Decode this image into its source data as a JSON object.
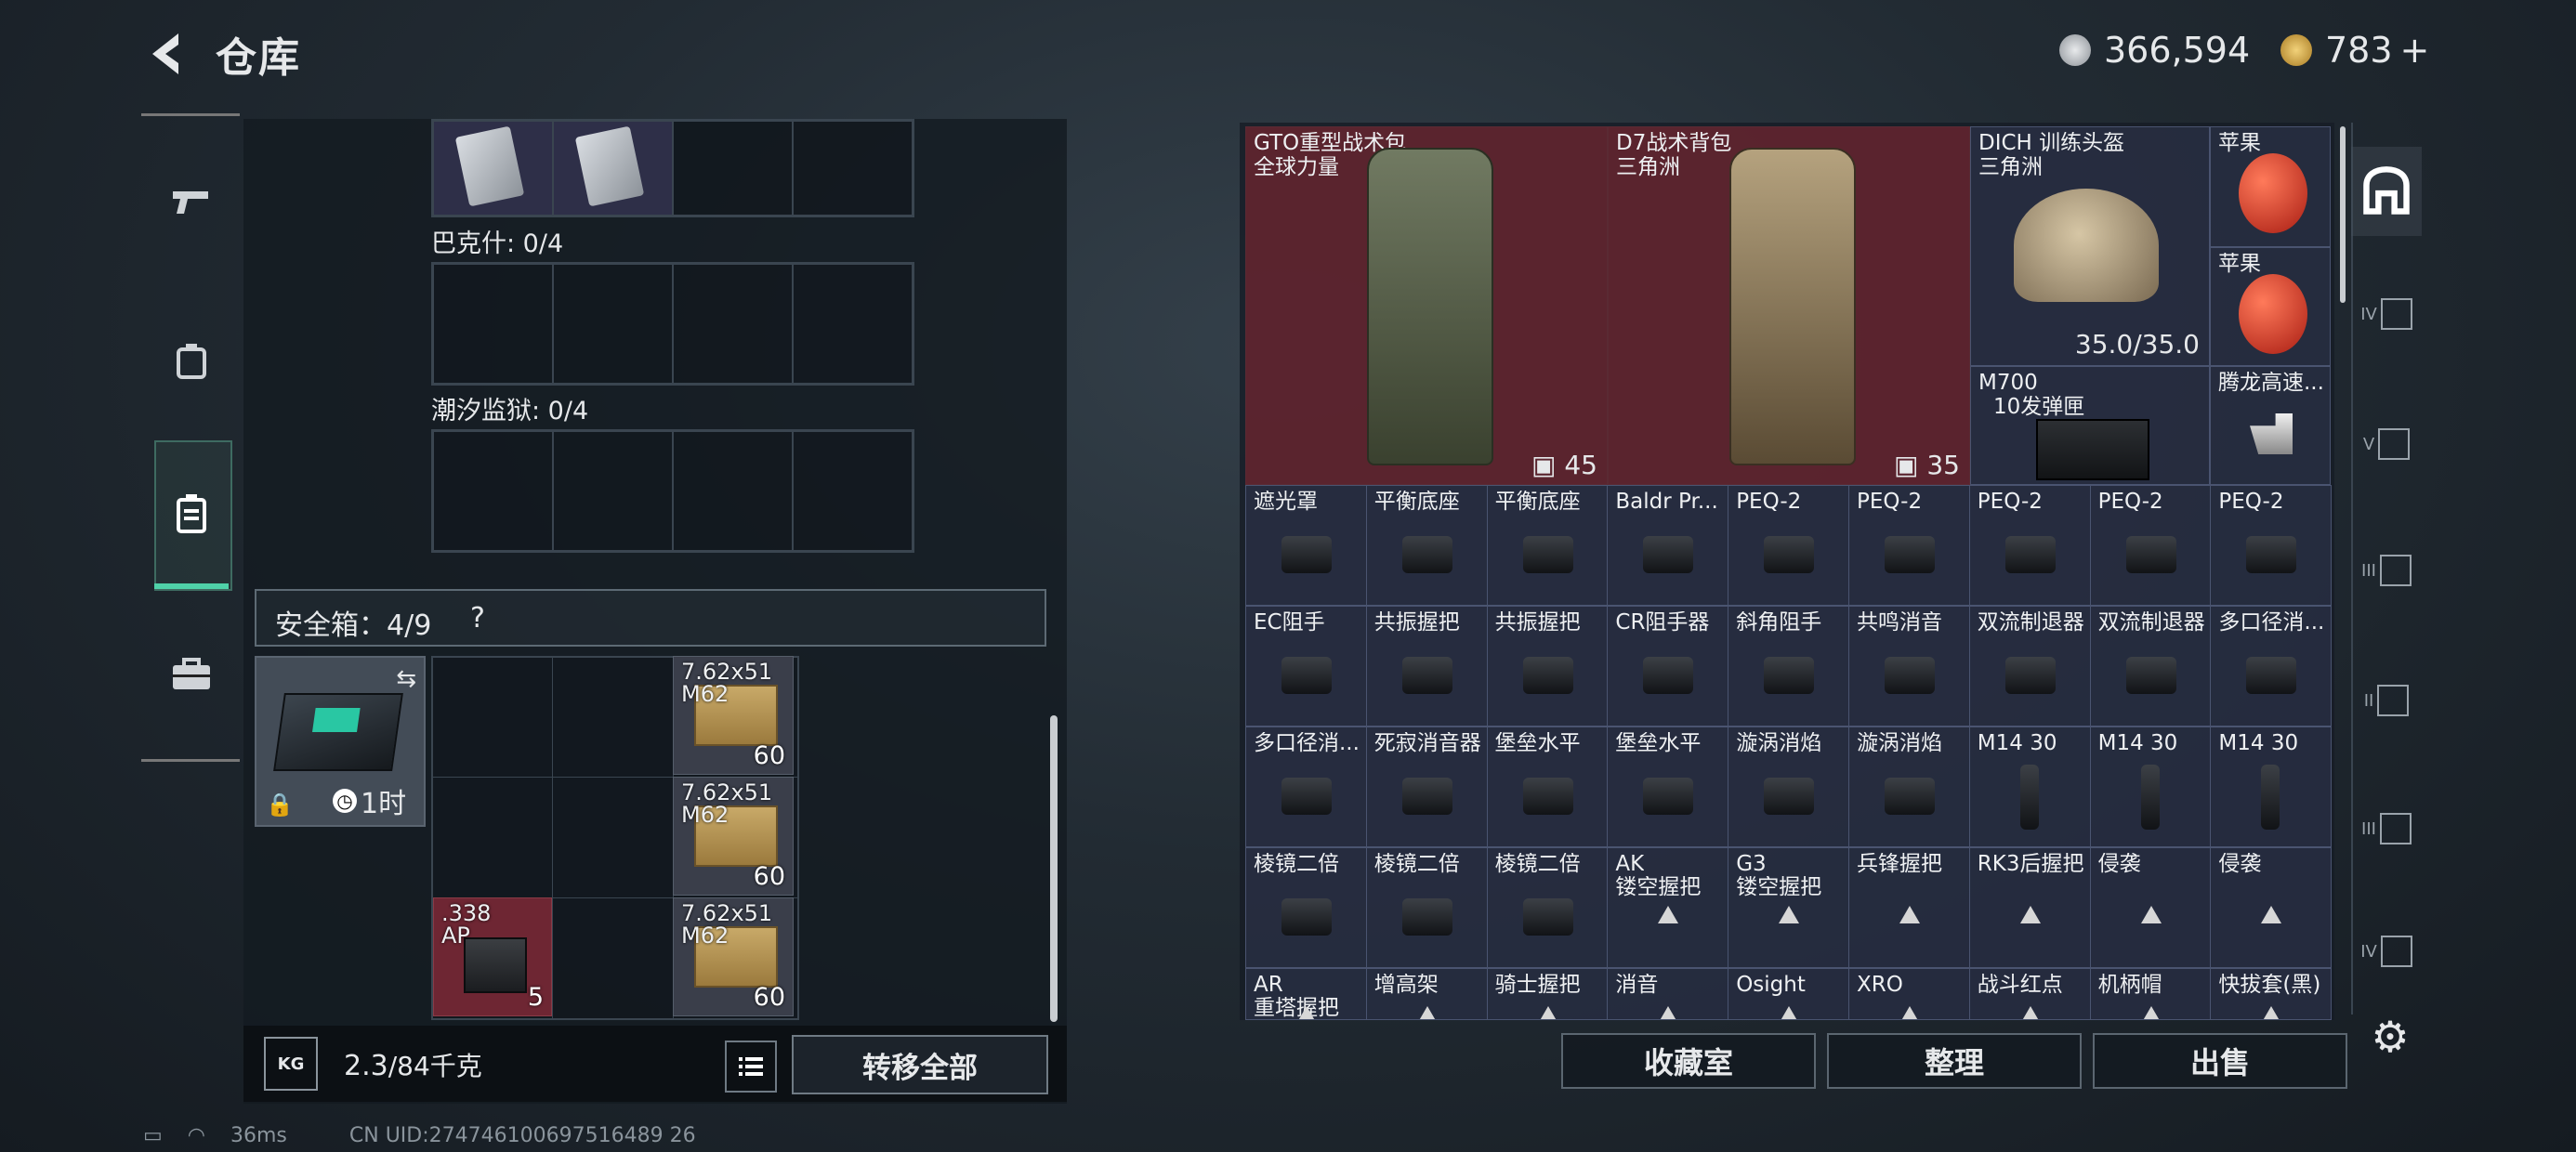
{
  "header": {
    "title": "仓库",
    "currency1": "366,594",
    "currency2": "783",
    "plus": "+"
  },
  "colors": {
    "accent": "#4fd1a8",
    "red_cell": "#702630",
    "grid_cell": "#2c3248"
  },
  "left": {
    "bark_label": "巴克什: 0/4",
    "tide_label": "潮汐监狱: 0/4",
    "safebox": {
      "label": "安全箱：4/9",
      "help": "?",
      "timer": "1时"
    },
    "items": [
      {
        "name": "7.62x51",
        "sub": "M62",
        "count": "60"
      },
      {
        "name": "7.62x51",
        "sub": "M62",
        "count": "60"
      },
      {
        "name": ".338",
        "sub": "AP",
        "count": "5"
      },
      {
        "name": "7.62x51",
        "sub": "M62",
        "count": "60"
      }
    ],
    "weight": "2.3",
    "weight_max": "/84千克",
    "transfer_all": "转移全部",
    "kg_icon": "KG"
  },
  "right": {
    "big": [
      {
        "name": "GTO重型战术包",
        "sub": "全球力量",
        "count": "45"
      },
      {
        "name": "D7战术背包",
        "sub": "三角洲",
        "count": "35"
      },
      {
        "name": "DICH 训练头盔",
        "sub": "三角洲",
        "dur": "35.0/35.0"
      }
    ],
    "apple1": "苹果",
    "apple2": "苹果",
    "m700": {
      "name": "M700",
      "sub": "10发弹匣"
    },
    "tenglong": "腾龙高速...",
    "rows": [
      [
        "遮光罩",
        "平衡底座",
        "平衡底座",
        "Baldr Pr...",
        "PEQ-2",
        "PEQ-2",
        "PEQ-2",
        "PEQ-2",
        "PEQ-2"
      ],
      [
        "EC阻手",
        "共振握把",
        "共振握把",
        "CR阻手器",
        "斜角阻手",
        "共鸣消音",
        "双流制退器",
        "双流制退器",
        "多口径消..."
      ],
      [
        "多口径消...",
        "死寂消音器",
        "堡垒水平",
        "堡垒水平",
        "漩涡消焰",
        "漩涡消焰",
        "M14 30",
        "M14 30",
        "M14 30"
      ],
      [
        "棱镜二倍",
        "棱镜二倍",
        "棱镜二倍",
        "AK",
        "G3",
        "兵锋握把",
        "RK3后握把",
        "侵袭",
        "侵袭"
      ],
      [
        "AR",
        "增高架",
        "骑士握把",
        "消音",
        "Osight",
        "XRO",
        "战斗红点",
        "机柄帽",
        "快拔套(黑)"
      ]
    ],
    "row3_subs": [
      "",
      "",
      "",
      "镂空握把",
      "镂空握把",
      "",
      "",
      "",
      ""
    ],
    "row4_subs": [
      "重塔握把",
      "",
      "",
      "",
      "",
      "",
      "",
      "",
      ""
    ]
  },
  "buttons": {
    "collection": "收藏室",
    "sort": "整理",
    "sell": "出售"
  },
  "tabs": [
    "IV",
    "V",
    "III",
    "II",
    "III",
    "IV"
  ],
  "status": {
    "ping": "36ms",
    "uid": "CN UID:274746100697516489 26"
  }
}
